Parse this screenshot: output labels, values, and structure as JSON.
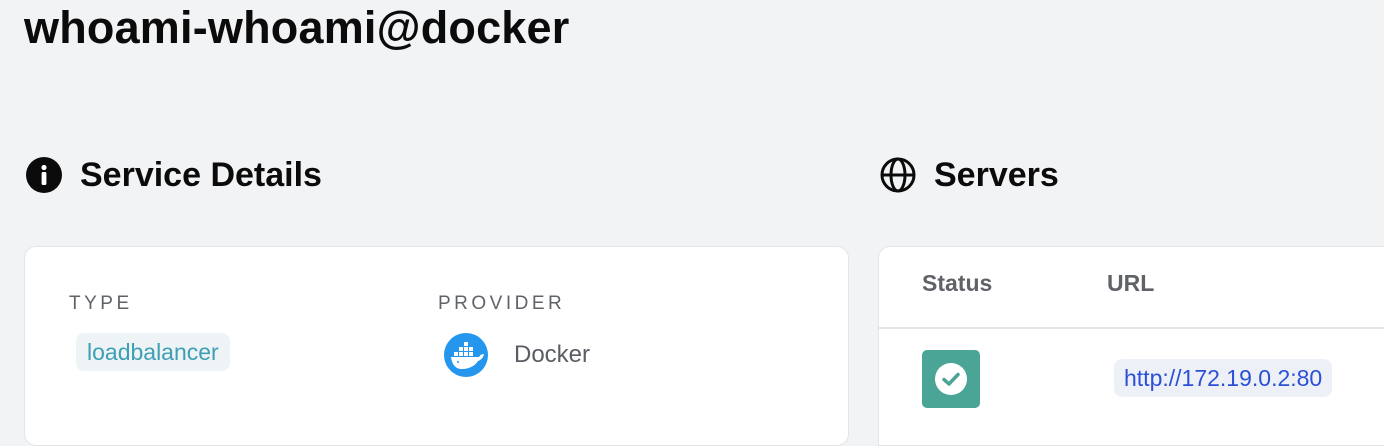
{
  "page": {
    "title": "whoami-whoami@docker"
  },
  "service_details": {
    "heading": "Service Details",
    "icon": "info-icon",
    "type_label": "TYPE",
    "type_value": "loadbalancer",
    "provider_label": "PROVIDER",
    "provider_name": "Docker",
    "provider_icon": "docker-icon"
  },
  "servers": {
    "heading": "Servers",
    "icon": "globe-icon",
    "columns": [
      "Status",
      "URL"
    ],
    "rows": [
      {
        "status_icon": "check-icon",
        "url": "http://172.19.0.2:80"
      }
    ]
  },
  "colors": {
    "type_pill_text": "#3c9fb5",
    "status_ok": "#4aa596",
    "url_text": "#2b50d6",
    "docker_blue": "#2496ed"
  }
}
